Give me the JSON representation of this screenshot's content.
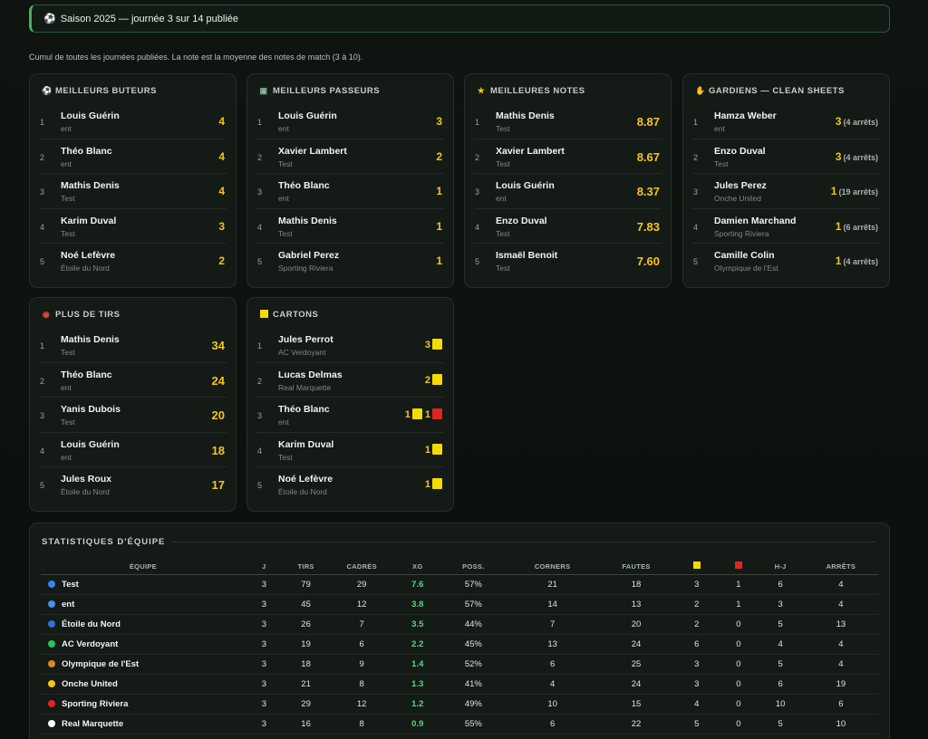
{
  "banner": {
    "icon": "⚽",
    "text": "Saison 2025 — journée 3 sur 14 publiée"
  },
  "note": "Cumul de toutes les journées publiées. La note est la moyenne des notes de match (3 à 10).",
  "scorers": {
    "icon": "⚽",
    "title": "MEILLEURS BUTEURS",
    "rows": [
      {
        "rank": "1",
        "name": "Louis Guérin",
        "team": "ent",
        "value": "4"
      },
      {
        "rank": "2",
        "name": "Théo Blanc",
        "team": "ent",
        "value": "4"
      },
      {
        "rank": "3",
        "name": "Mathis Denis",
        "team": "Test",
        "value": "4"
      },
      {
        "rank": "4",
        "name": "Karim Duval",
        "team": "Test",
        "value": "3"
      },
      {
        "rank": "5",
        "name": "Noé Lefèvre",
        "team": "Étoile du Nord",
        "value": "2"
      }
    ]
  },
  "assists": {
    "icon": "▣",
    "title": "MEILLEURS PASSEURS",
    "rows": [
      {
        "rank": "1",
        "name": "Louis Guérin",
        "team": "ent",
        "value": "3"
      },
      {
        "rank": "2",
        "name": "Xavier Lambert",
        "team": "Test",
        "value": "2"
      },
      {
        "rank": "3",
        "name": "Théo Blanc",
        "team": "ent",
        "value": "1"
      },
      {
        "rank": "4",
        "name": "Mathis Denis",
        "team": "Test",
        "value": "1"
      },
      {
        "rank": "5",
        "name": "Gabriel Perez",
        "team": "Sporting Riviera",
        "value": "1"
      }
    ]
  },
  "ratings": {
    "icon": "★",
    "title": "MEILLEURES NOTES",
    "rows": [
      {
        "rank": "1",
        "name": "Mathis Denis",
        "team": "Test",
        "value": "8.87"
      },
      {
        "rank": "2",
        "name": "Xavier Lambert",
        "team": "Test",
        "value": "8.67"
      },
      {
        "rank": "3",
        "name": "Louis Guérin",
        "team": "ent",
        "value": "8.37"
      },
      {
        "rank": "4",
        "name": "Enzo Duval",
        "team": "Test",
        "value": "7.83"
      },
      {
        "rank": "5",
        "name": "Ismaël Benoit",
        "team": "Test",
        "value": "7.60"
      }
    ]
  },
  "keepers": {
    "icon": "✋",
    "title": "GARDIENS — CLEAN SHEETS",
    "rows": [
      {
        "rank": "1",
        "name": "Hamza Weber",
        "team": "ent",
        "value": "3",
        "sub": "(4 arrêts)"
      },
      {
        "rank": "2",
        "name": "Enzo Duval",
        "team": "Test",
        "value": "3",
        "sub": "(4 arrêts)"
      },
      {
        "rank": "3",
        "name": "Jules Perez",
        "team": "Onche United",
        "value": "1",
        "sub": "(19 arrêts)"
      },
      {
        "rank": "4",
        "name": "Damien Marchand",
        "team": "Sporting Riviera",
        "value": "1",
        "sub": "(6 arrêts)"
      },
      {
        "rank": "5",
        "name": "Camille Colin",
        "team": "Olympique de l'Est",
        "value": "1",
        "sub": "(4 arrêts)"
      }
    ]
  },
  "shots": {
    "icon": "◉",
    "title": "PLUS DE TIRS",
    "rows": [
      {
        "rank": "1",
        "name": "Mathis Denis",
        "team": "Test",
        "value": "34"
      },
      {
        "rank": "2",
        "name": "Théo Blanc",
        "team": "ent",
        "value": "24"
      },
      {
        "rank": "3",
        "name": "Yanis Dubois",
        "team": "Test",
        "value": "20"
      },
      {
        "rank": "4",
        "name": "Louis Guérin",
        "team": "ent",
        "value": "18"
      },
      {
        "rank": "5",
        "name": "Jules Roux",
        "team": "Étoile du Nord",
        "value": "17"
      }
    ]
  },
  "cards": {
    "title": "CARTONS",
    "rows": [
      {
        "rank": "1",
        "name": "Jules Perrot",
        "team": "AC Verdoyant",
        "yellow": "3",
        "red": ""
      },
      {
        "rank": "2",
        "name": "Lucas Delmas",
        "team": "Real Marquette",
        "yellow": "2",
        "red": ""
      },
      {
        "rank": "3",
        "name": "Théo Blanc",
        "team": "ent",
        "yellow": "1",
        "red": "1"
      },
      {
        "rank": "4",
        "name": "Karim Duval",
        "team": "Test",
        "yellow": "1",
        "red": ""
      },
      {
        "rank": "5",
        "name": "Noé Lefèvre",
        "team": "Étoile du Nord",
        "yellow": "1",
        "red": ""
      }
    ]
  },
  "teams": {
    "title": "STATISTIQUES D'ÉQUIPE",
    "headers": [
      "ÉQUIPE",
      "J",
      "TIRS",
      "CADRÉS",
      "XG",
      "POSS.",
      "CORNERS",
      "FAUTES",
      "",
      "",
      "H-J",
      "ARRÊTS"
    ],
    "rows": [
      {
        "color": "#3b82f6",
        "name": "Test",
        "j": "3",
        "tirs": "79",
        "cadres": "29",
        "xg": "7.6",
        "poss": "57%",
        "corners": "21",
        "fautes": "18",
        "y": "3",
        "r": "1",
        "hj": "6",
        "arrets": "4"
      },
      {
        "color": "#4a90e2",
        "name": "ent",
        "j": "3",
        "tirs": "45",
        "cadres": "12",
        "xg": "3.8",
        "poss": "57%",
        "corners": "14",
        "fautes": "13",
        "y": "2",
        "r": "1",
        "hj": "3",
        "arrets": "4"
      },
      {
        "color": "#2f6fd6",
        "name": "Étoile du Nord",
        "j": "3",
        "tirs": "26",
        "cadres": "7",
        "xg": "3.5",
        "poss": "44%",
        "corners": "7",
        "fautes": "20",
        "y": "2",
        "r": "0",
        "hj": "5",
        "arrets": "13"
      },
      {
        "color": "#22c55e",
        "name": "AC Verdoyant",
        "j": "3",
        "tirs": "19",
        "cadres": "6",
        "xg": "2.2",
        "poss": "45%",
        "corners": "13",
        "fautes": "24",
        "y": "6",
        "r": "0",
        "hj": "4",
        "arrets": "4"
      },
      {
        "color": "#e0862a",
        "name": "Olympique de l'Est",
        "j": "3",
        "tirs": "18",
        "cadres": "9",
        "xg": "1.4",
        "poss": "52%",
        "corners": "6",
        "fautes": "25",
        "y": "3",
        "r": "0",
        "hj": "5",
        "arrets": "4"
      },
      {
        "color": "#f5c518",
        "name": "Onche United",
        "j": "3",
        "tirs": "21",
        "cadres": "8",
        "xg": "1.3",
        "poss": "41%",
        "corners": "4",
        "fautes": "24",
        "y": "3",
        "r": "0",
        "hj": "6",
        "arrets": "19"
      },
      {
        "color": "#e02424",
        "name": "Sporting Riviera",
        "j": "3",
        "tirs": "29",
        "cadres": "12",
        "xg": "1.2",
        "poss": "49%",
        "corners": "10",
        "fautes": "15",
        "y": "4",
        "r": "0",
        "hj": "10",
        "arrets": "6"
      },
      {
        "color": "#ffffff",
        "name": "Real Marquette",
        "j": "3",
        "tirs": "16",
        "cadres": "8",
        "xg": "0.9",
        "poss": "55%",
        "corners": "6",
        "fautes": "22",
        "y": "5",
        "r": "0",
        "hj": "5",
        "arrets": "10"
      }
    ]
  }
}
